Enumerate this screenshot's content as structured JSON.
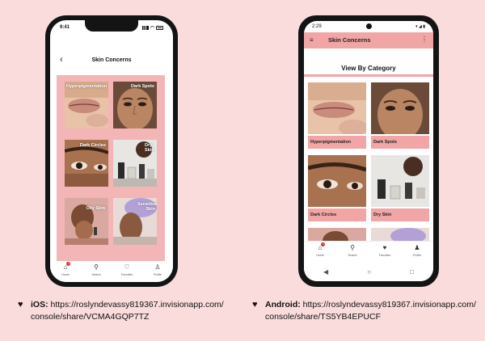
{
  "ios": {
    "status_time": "9:41",
    "header_title": "Skin Concerns",
    "tiles": [
      {
        "label": "Hyperpigmentation"
      },
      {
        "label": "Dark Spots"
      },
      {
        "label": "Dark Circles"
      },
      {
        "label": "Dry Skin"
      },
      {
        "label": "Oily Skin"
      },
      {
        "label": "Sensitive Skin"
      }
    ],
    "tabs": [
      {
        "label": "Home",
        "icon": "home-icon",
        "badge": "1"
      },
      {
        "label": "Search",
        "icon": "search-icon"
      },
      {
        "label": "Favorites",
        "icon": "heart-icon"
      },
      {
        "label": "Profile",
        "icon": "person-icon"
      }
    ]
  },
  "android": {
    "status_time": "2:29",
    "appbar_title": "Skin Concerns",
    "section_title": "View By Category",
    "cards": [
      {
        "label": "Hyperpigmentation"
      },
      {
        "label": "Dark Spots"
      },
      {
        "label": "Dark Circles"
      },
      {
        "label": "Dry Skin"
      },
      {
        "label": ""
      },
      {
        "label": ""
      }
    ],
    "nav": [
      {
        "label": "Home",
        "icon": "home-icon",
        "badge": "1"
      },
      {
        "label": "Search",
        "icon": "search-icon"
      },
      {
        "label": "Favorites",
        "icon": "heart-icon"
      },
      {
        "label": "Profile",
        "icon": "person-icon"
      }
    ]
  },
  "captions": {
    "ios_prefix": "iOS:",
    "ios_link_line1": " https://roslyndevassy819367.invisionapp.com/",
    "ios_link_line2": "console/share/VCMA4GQP7TZ",
    "android_prefix": "Android:",
    "android_link_line1": " https://roslyndevassy819367.invisionapp.com/",
    "android_link_line2": "console/share/TS5YB4EPUCF"
  },
  "colors": {
    "background": "#fadcdc",
    "accent_pink": "#f2a5a5",
    "phone_frame": "#141414"
  }
}
